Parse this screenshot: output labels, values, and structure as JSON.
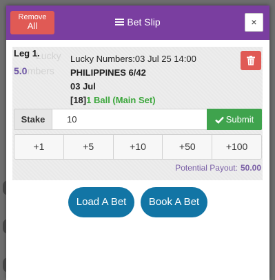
{
  "header": {
    "remove_all_line1": "Remove",
    "remove_all_line2": "All",
    "title": "Bet Slip",
    "close_label": "×"
  },
  "leg": {
    "label": "Leg 1.",
    "odds": "5.0",
    "ghost_line1": "Lucky",
    "ghost_line2": "Numbers",
    "market": "Lucky Numbers:03 Jul 25 14:00",
    "event": "PHILIPPINES 6/42",
    "date": "03 Jul",
    "selection_num": "[18]",
    "selection_name": "1 Ball (Main Set)"
  },
  "stake": {
    "label": "Stake",
    "value": "10",
    "submit_label": "Submit"
  },
  "quick_stakes": [
    "+1",
    "+5",
    "+10",
    "+50",
    "+100"
  ],
  "payout": {
    "label": "Potential Payout:",
    "value": "50.00"
  },
  "actions": {
    "load_label": "Load A Bet",
    "book_label": "Book A Bet"
  },
  "colors": {
    "header_bg": "#7a3ea0",
    "danger": "#e05a55",
    "success": "#3fa34d",
    "primary": "#1275a5",
    "odds": "#6f56a6"
  },
  "icons": {
    "title": "list-icon",
    "delete": "trash-icon",
    "submit": "check-icon"
  }
}
